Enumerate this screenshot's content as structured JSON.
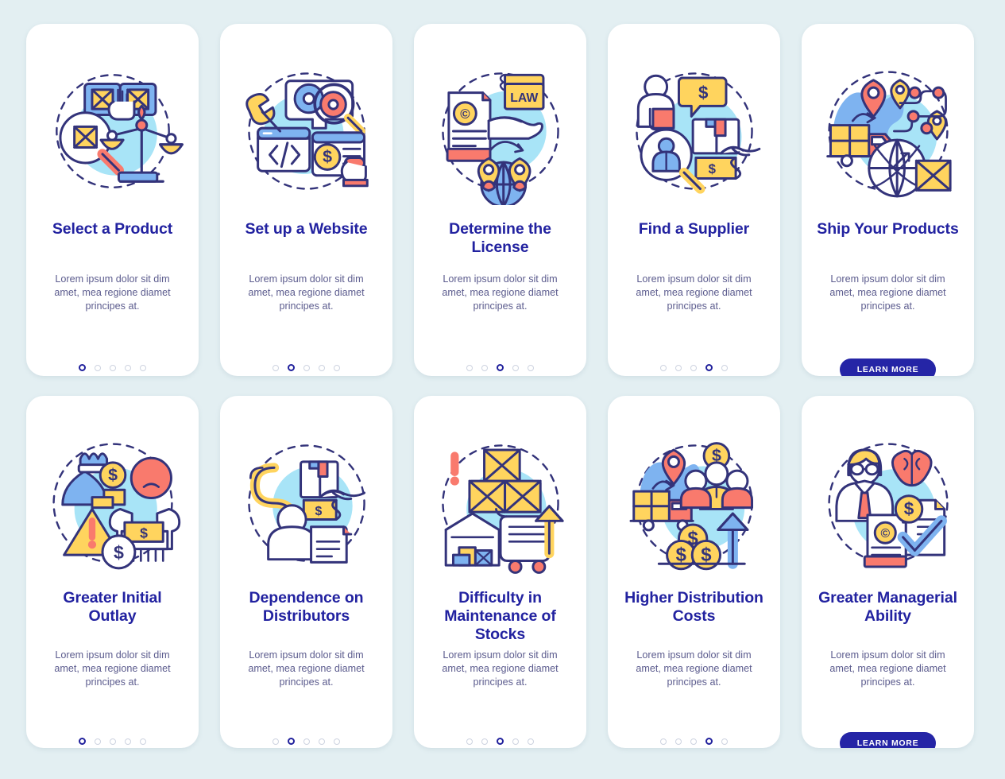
{
  "page": {
    "background_color": "#e3eff2",
    "card_background": "#ffffff",
    "title_color": "#2222a0",
    "body_color": "#5c5c8e",
    "accent_navy": "#2525a6",
    "palette": {
      "outline": "#33337a",
      "yellow": "#ffd45e",
      "coral": "#f97a6d",
      "blue": "#7eb3f0",
      "cyan_circle": "#a8e4f7",
      "light_blue": "#bcd8fa"
    }
  },
  "shared": {
    "description": "Lorem ipsum dolor sit dim amet, mea regione diamet principes at.",
    "learn_more_label": "LEARN MORE",
    "dot_count": 5
  },
  "rows": [
    {
      "name": "row-1",
      "cards": [
        {
          "title": "Select a Product",
          "illustration": "product-selection-illustration",
          "description": "Lorem ipsum dolor sit dim amet, mea regione diamet principes at.",
          "active_dot": 0,
          "has_button": false
        },
        {
          "title": "Set up a Website",
          "illustration": "website-setup-illustration",
          "description": "Lorem ipsum dolor sit dim amet, mea regione diamet principes at.",
          "active_dot": 1,
          "has_button": false
        },
        {
          "title": "Determine the License",
          "illustration": "license-illustration",
          "description": "Lorem ipsum dolor sit dim amet, mea regione diamet principes at.",
          "active_dot": 2,
          "has_button": false
        },
        {
          "title": "Find a Supplier",
          "illustration": "supplier-search-illustration",
          "description": "Lorem ipsum dolor sit dim amet, mea regione diamet principes at.",
          "active_dot": 3,
          "has_button": false
        },
        {
          "title": "Ship Your Products",
          "illustration": "shipping-illustration",
          "description": "Lorem ipsum dolor sit dim amet, mea regione diamet principes at.",
          "active_dot": 4,
          "has_button": true,
          "button_label": "LEARN MORE"
        }
      ]
    },
    {
      "name": "row-2",
      "cards": [
        {
          "title": "Greater Initial Outlay",
          "illustration": "initial-outlay-illustration",
          "description": "Lorem ipsum dolor sit dim amet, mea regione diamet principes at.",
          "active_dot": 0,
          "has_button": false
        },
        {
          "title": "Dependence on Distributors",
          "illustration": "distributor-dependence-illustration",
          "description": "Lorem ipsum dolor sit dim amet, mea regione diamet principes at.",
          "active_dot": 1,
          "has_button": false
        },
        {
          "title": "Difficulty in Maintenance of Stocks",
          "illustration": "stock-maintenance-illustration",
          "description": "Lorem ipsum dolor sit dim amet, mea regione diamet principes at.",
          "active_dot": 2,
          "has_button": false
        },
        {
          "title": "Higher Distribution Costs",
          "illustration": "distribution-costs-illustration",
          "description": "Lorem ipsum dolor sit dim amet, mea regione diamet principes at.",
          "active_dot": 3,
          "has_button": false
        },
        {
          "title": "Greater Managerial Ability",
          "illustration": "managerial-ability-illustration",
          "description": "Lorem ipsum dolor sit dim amet, mea regione diamet principes at.",
          "active_dot": 4,
          "has_button": true,
          "button_label": "LEARN MORE"
        }
      ]
    }
  ]
}
